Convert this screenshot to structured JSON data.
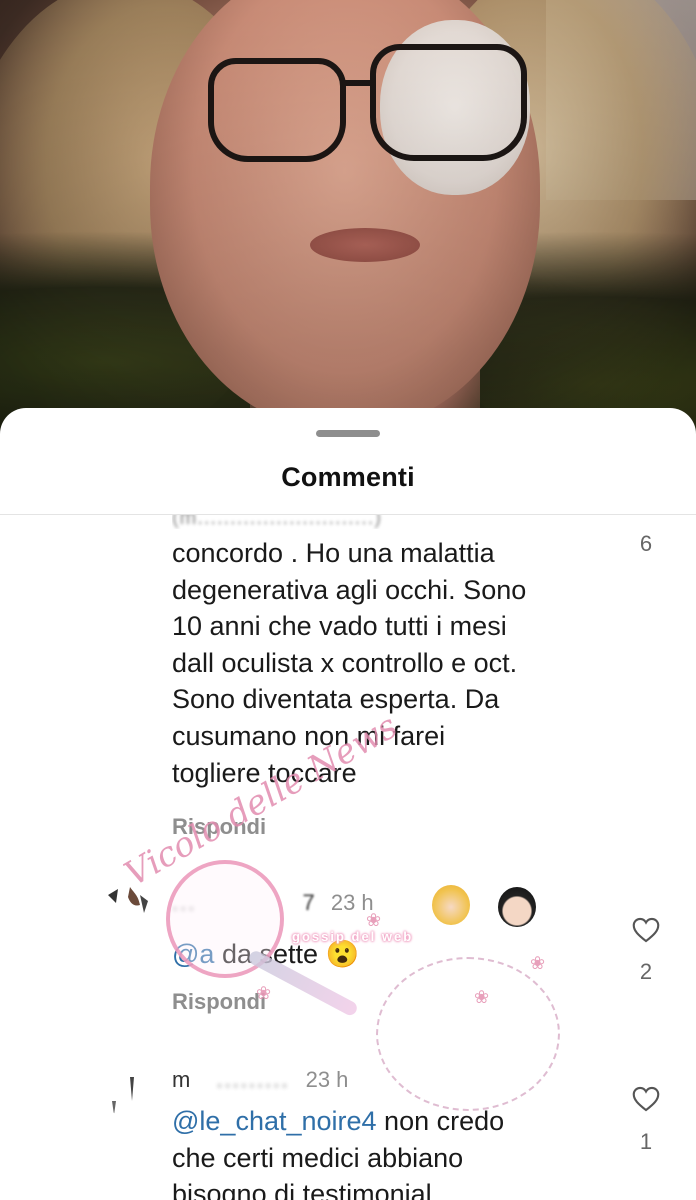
{
  "sheet": {
    "title": "Commenti"
  },
  "comments": [
    {
      "text_lines": [
        "concordo . Ho una malattia",
        "degenerativa agli occhi.  Sono",
        "10 anni che vado tutti i mesi",
        "dall oculista x controllo e oct.",
        "Sono diventata esperta. Da",
        "cusumano non mi farei",
        "togliere toccare"
      ],
      "reply_label": "Rispondi",
      "likes": "6"
    },
    {
      "username_partial": "...",
      "username_end": "7",
      "time": "23 h",
      "mention": "@a",
      "text": " da sette ",
      "emoji": "😮",
      "reply_label": "Rispondi",
      "likes": "2"
    },
    {
      "username_partial": "m",
      "username_end": "",
      "time": "23 h",
      "mention": "@le_chat_noire4",
      "text_first": " non credo",
      "text_lines": [
        "che certi medici abbiano",
        "bisogno di testimonial."
      ],
      "likes": "1"
    }
  ],
  "watermark": {
    "script_text": "Vicolo delle News",
    "banner_text": "gossip del web"
  },
  "icons": {
    "like": "heart-icon",
    "handle": "drag-handle"
  },
  "colors": {
    "mention": "#2f6fa8",
    "secondary": "#8e8e8e"
  }
}
